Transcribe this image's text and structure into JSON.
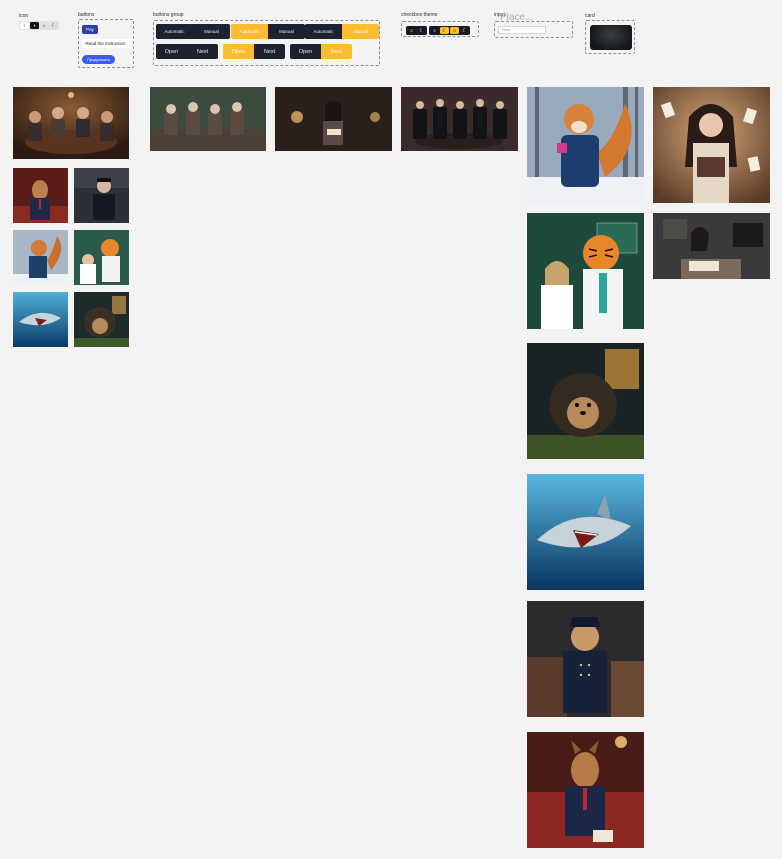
{
  "sections": {
    "icon_label": "icon",
    "buttons_label": "buttons",
    "buttons_group_label": "buttons group",
    "checkbox_theme_label": "checkbox theme",
    "input_label": "input",
    "card_label": "card"
  },
  "icon_group": [
    {
      "icon": "chevron-icon",
      "glyph": "‹"
    },
    {
      "icon": "theme-icon",
      "glyph": "◑"
    },
    {
      "icon": "sun-icon",
      "glyph": "☼"
    },
    {
      "icon": "moon-icon",
      "glyph": "☾"
    }
  ],
  "buttons": {
    "pay": "Pay",
    "read": "Read the instruction",
    "continue": "Продолжить"
  },
  "button_groups": {
    "row1": [
      [
        "Automatic",
        "Manual"
      ],
      [
        "Automatic",
        "Manual"
      ],
      [
        "Automatic",
        "Manual"
      ]
    ],
    "row2": [
      [
        "Open",
        "Next"
      ],
      [
        "Open",
        "Next"
      ],
      [
        "Open",
        "Next"
      ]
    ]
  },
  "checkbox_theme": {
    "group1": [
      "☼",
      "☾"
    ],
    "group2": [
      "☼",
      "☾",
      "☼",
      "☾"
    ]
  },
  "input": {
    "placeholder_large": "Place...",
    "placeholder_small": "Place"
  },
  "colors": {
    "dark": "#1c2230",
    "yellow": "#fbbd2e",
    "blue": "#2f3fa8",
    "bright_blue": "#3b5bf3"
  },
  "gallery": {
    "left_grid": [
      "dog-in-suit",
      "man-in-suit",
      "squirrel",
      "tiger-doctor",
      "shark",
      "hedgehog"
    ],
    "top_row": [
      "poker-players",
      "elderly-group",
      "woman-reading",
      "men-in-suits"
    ],
    "column_a": [
      "squirrel",
      "tiger-doctor",
      "hedgehog",
      "shark",
      "cat-officer",
      "dog-in-suit"
    ],
    "column_b": [
      "woman-with-cards",
      "woman-drawing"
    ]
  }
}
